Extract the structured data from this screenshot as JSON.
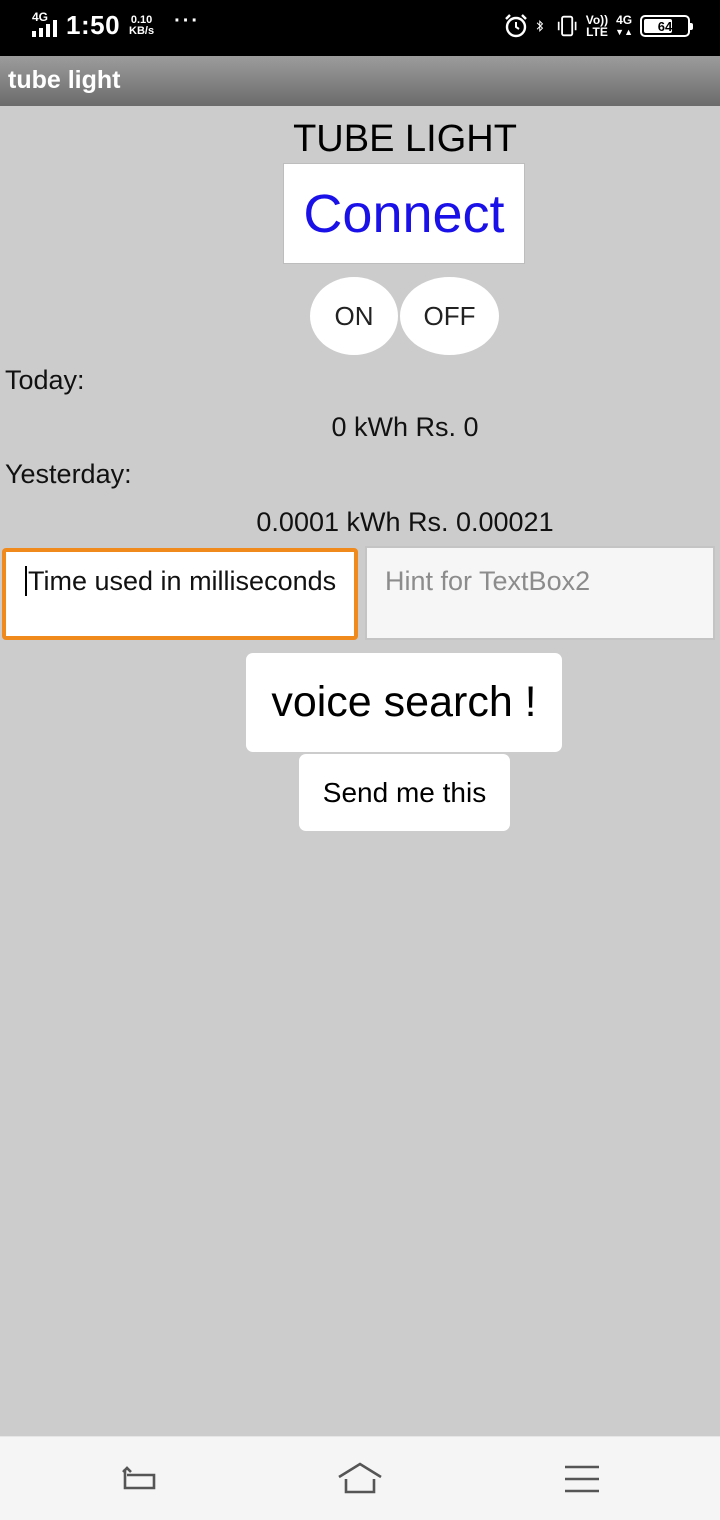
{
  "status_bar": {
    "network": "4G",
    "time": "1:50",
    "speed_value": "0.10",
    "speed_unit": "KB/s",
    "more": "···",
    "volte_top": "Vo))",
    "volte_bottom": "LTE",
    "net2": "4G",
    "battery": "64",
    "icons": [
      "alarm-icon",
      "bluetooth-icon",
      "vibrate-icon",
      "battery-icon"
    ]
  },
  "app": {
    "window_title": "tube light",
    "heading": "TUBE LIGHT",
    "connect_label": "Connect",
    "on_label": "ON",
    "off_label": "OFF",
    "today_label": "Today:",
    "today_value": "0 kWh Rs. 0",
    "yesterday_label": "Yesterday:",
    "yesterday_value": "0.0001 kWh Rs. 0.00021",
    "textbox1_value": "Time used in milliseconds",
    "textbox2_placeholder": "Hint for TextBox2",
    "voice_label": "voice search !",
    "send_label": "Send me this"
  },
  "nav_bar": {
    "icons": [
      "back-icon",
      "home-icon",
      "menu-icon"
    ]
  },
  "colors": {
    "background": "#cccccc",
    "connect_text": "#1a10e8",
    "focus_border": "#f08a1d",
    "status_bar": "#000000"
  }
}
